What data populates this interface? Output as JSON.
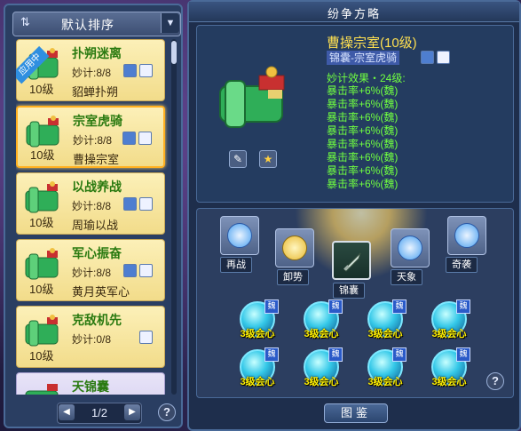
{
  "left_panel": {
    "sort_label": "默认排序",
    "in_use_tag": "应用中",
    "cards": [
      {
        "name": "扑朔迷离",
        "count": "妙计:8/8",
        "owner": "貂蝉扑朔",
        "level": "10级",
        "in_use": true,
        "selected": false
      },
      {
        "name": "宗室虎骑",
        "count": "妙计:8/8",
        "owner": "曹操宗室",
        "level": "10级",
        "in_use": false,
        "selected": true
      },
      {
        "name": "以战养战",
        "count": "妙计:8/8",
        "owner": "周瑜以战",
        "level": "10级",
        "in_use": false,
        "selected": false
      },
      {
        "name": "军心振奋",
        "count": "妙计:8/8",
        "owner": "黄月英军心",
        "level": "10级",
        "in_use": false,
        "selected": false
      },
      {
        "name": "克敌机先",
        "count": "妙计:0/8",
        "owner": "",
        "level": "10级",
        "in_use": false,
        "selected": false
      },
      {
        "name": "天锦囊",
        "count": "",
        "owner": "",
        "level": "",
        "in_use": false,
        "selected": false
      }
    ],
    "page": "1/2",
    "help": "?"
  },
  "right_panel": {
    "title": "纷争方略",
    "item_title": "曹操宗室(10级)",
    "item_subtitle": "锦囊-宗室虎骑",
    "effect_head": "妙计效果・24级:",
    "effects": [
      "暴击率+6%(魏)",
      "暴击率+6%(魏)",
      "暴击率+6%(魏)",
      "暴击率+6%(魏)",
      "暴击率+6%(魏)",
      "暴击率+6%(魏)",
      "暴击率+6%(魏)",
      "暴击率+6%(魏)"
    ],
    "slots": [
      {
        "label": "再战",
        "icon": "refresh-icon"
      },
      {
        "label": "卸势",
        "icon": "shield-icon"
      },
      {
        "label": "锦囊",
        "icon": "sword-icon"
      },
      {
        "label": "天象",
        "icon": "fan-icon"
      },
      {
        "label": "奇袭",
        "icon": "swirl-icon"
      }
    ],
    "orbs": [
      {
        "level": "3级会心",
        "tag": "魏"
      },
      {
        "level": "3级会心",
        "tag": "魏"
      },
      {
        "level": "3级会心",
        "tag": "魏"
      },
      {
        "level": "3级会心",
        "tag": "魏"
      },
      {
        "level": "3级会心",
        "tag": "魏"
      },
      {
        "level": "3级会心",
        "tag": "魏"
      },
      {
        "level": "3级会心",
        "tag": "魏"
      },
      {
        "level": "3级会心",
        "tag": "魏"
      }
    ],
    "catalog_button": "图鉴",
    "help": "?"
  },
  "colors": {
    "accent": "#ffe050",
    "effect_green": "#70ff40",
    "card_yellow": "#f2dc8a",
    "panel": "#243c60"
  }
}
